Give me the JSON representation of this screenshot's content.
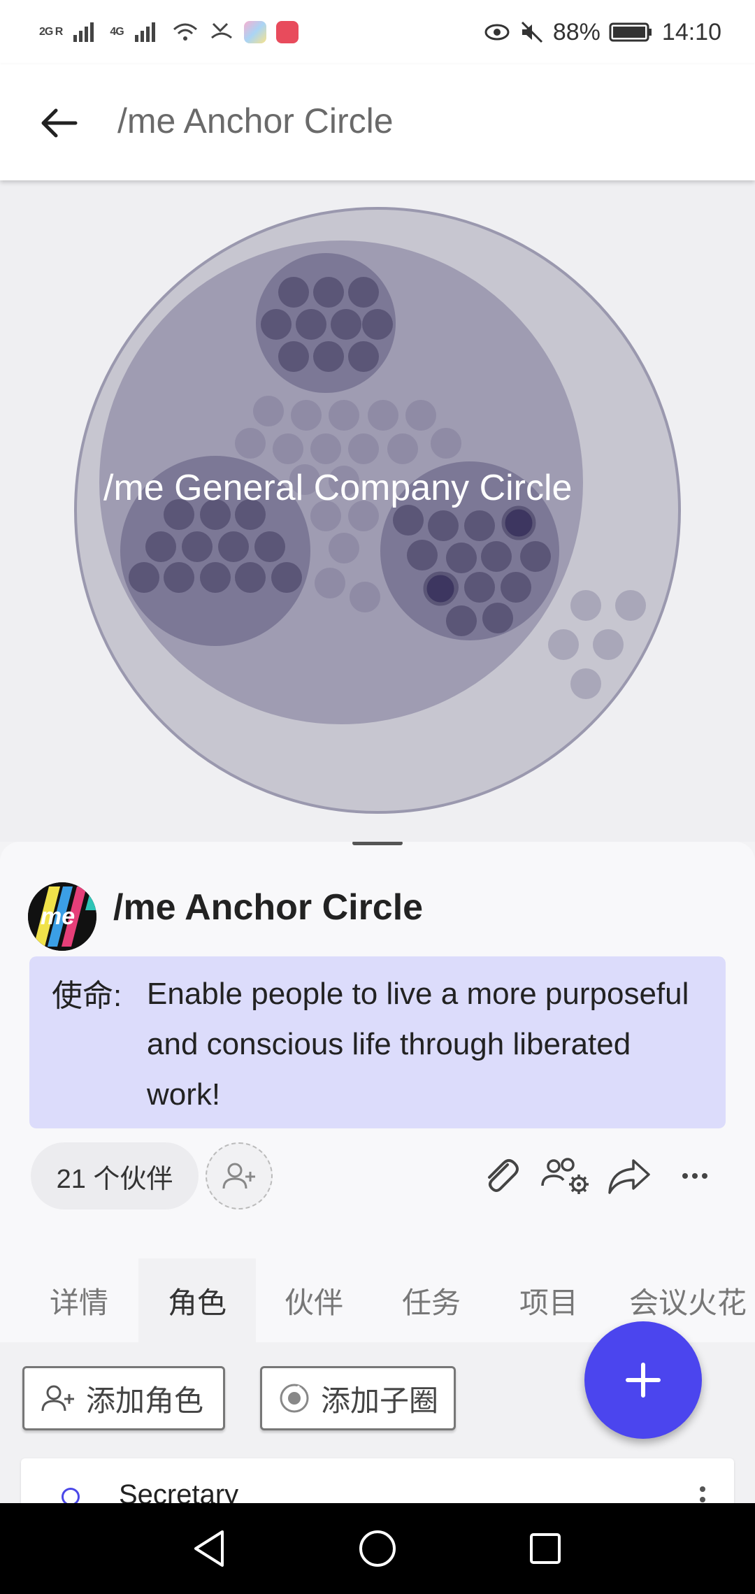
{
  "status_bar": {
    "signal_left": "2G R",
    "signal_right": "4G",
    "battery": "88%",
    "time": "14:10",
    "icons": [
      "signal-icon",
      "wifi-icon",
      "missed-call-icon",
      "app-icon",
      "app-icon",
      "eye-icon",
      "mute-icon",
      "battery-icon"
    ]
  },
  "appbar": {
    "title": "/me Anchor Circle"
  },
  "canvas": {
    "circle_label": "/me General Company Circle"
  },
  "circle": {
    "name": "/me Anchor Circle",
    "avatar_text": "me",
    "purpose_label": "使命:",
    "purpose_text": "Enable people to live a more purposeful and conscious life through liberated work!",
    "partners_count_label": "21 个伙伴"
  },
  "tabs": [
    {
      "label": "详情",
      "active": false
    },
    {
      "label": "角色",
      "active": true
    },
    {
      "label": "伙伴",
      "active": false
    },
    {
      "label": "任务",
      "active": false
    },
    {
      "label": "项目",
      "active": false
    },
    {
      "label": "会议火花",
      "active": false
    }
  ],
  "buttons": {
    "add_role": "添加角色",
    "add_subcircle": "添加子圈"
  },
  "roles": [
    {
      "name": "Secretary"
    }
  ],
  "colors": {
    "accent": "#4b45ee",
    "purpose_bg": "#dcdcfb",
    "circle_outer": "#c6c5cf",
    "circle_inner": "#9e9bb0"
  }
}
